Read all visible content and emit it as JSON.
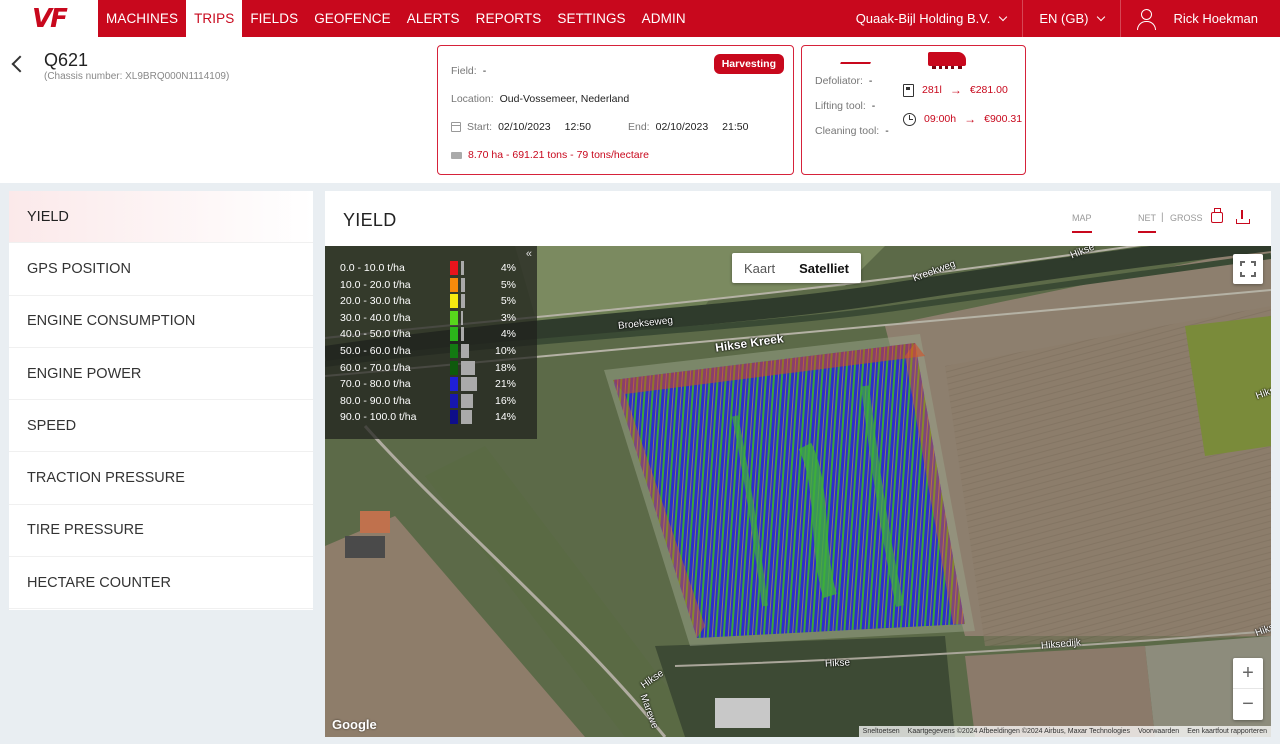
{
  "brand": {
    "logo_text": "VF"
  },
  "nav": {
    "items": [
      {
        "label": "MACHINES"
      },
      {
        "label": "TRIPS"
      },
      {
        "label": "FIELDS"
      },
      {
        "label": "GEOFENCE"
      },
      {
        "label": "ALERTS"
      },
      {
        "label": "REPORTS"
      },
      {
        "label": "SETTINGS"
      },
      {
        "label": "ADMIN"
      }
    ],
    "active": "TRIPS",
    "company": "Quaak-Bijl Holding B.V.",
    "language": "EN (GB)",
    "user": "Rick Hoekman"
  },
  "machine": {
    "title": "Q621",
    "chassis": "(Chassis number: XL9BRQ000N1114109)"
  },
  "trip": {
    "status": "Harvesting",
    "field_label": "Field:",
    "field_value": "-",
    "location_label": "Location:",
    "location_value": "Oud-Vossemeer, Nederland",
    "start_label": "Start:",
    "start_date": "02/10/2023",
    "start_time": "12:50",
    "end_label": "End:",
    "end_date": "02/10/2023",
    "end_time": "21:50",
    "summary": "8.70 ha - 691.21 tons - 79 tons/hectare"
  },
  "tools": {
    "defoliator_label": "Defoliator:",
    "defoliator_value": "-",
    "lifting_label": "Lifting tool:",
    "lifting_value": "-",
    "cleaning_label": "Cleaning tool:",
    "cleaning_value": "-",
    "fuel": "281l",
    "fuel_cost": "€281.00",
    "hours": "09:00h",
    "hours_cost": "€900.31"
  },
  "sidebar": {
    "items": [
      {
        "label": "YIELD"
      },
      {
        "label": "GPS POSITION"
      },
      {
        "label": "ENGINE CONSUMPTION"
      },
      {
        "label": "ENGINE POWER"
      },
      {
        "label": "SPEED"
      },
      {
        "label": "TRACTION PRESSURE"
      },
      {
        "label": "TIRE PRESSURE"
      },
      {
        "label": "HECTARE COUNTER"
      }
    ],
    "active": "YIELD"
  },
  "panel": {
    "title": "YIELD",
    "tab_map": "MAP",
    "tab_net": "NET",
    "separator": "|",
    "tab_gross": "GROSS"
  },
  "legend": {
    "collapse": "«",
    "rows": [
      {
        "label": "0.0 - 10.0 t/ha",
        "pct": "4%",
        "value": 4,
        "color": "#e8141c"
      },
      {
        "label": "10.0 - 20.0 t/ha",
        "pct": "5%",
        "value": 5,
        "color": "#f58a0b"
      },
      {
        "label": "20.0 - 30.0 t/ha",
        "pct": "5%",
        "value": 5,
        "color": "#f6ea10"
      },
      {
        "label": "30.0 - 40.0 t/ha",
        "pct": "3%",
        "value": 3,
        "color": "#58d61c"
      },
      {
        "label": "40.0 - 50.0 t/ha",
        "pct": "4%",
        "value": 4,
        "color": "#2bb51a"
      },
      {
        "label": "50.0 - 60.0 t/ha",
        "pct": "10%",
        "value": 10,
        "color": "#137a12"
      },
      {
        "label": "60.0 - 70.0 t/ha",
        "pct": "18%",
        "value": 18,
        "color": "#0e5a0c"
      },
      {
        "label": "70.0 - 80.0 t/ha",
        "pct": "21%",
        "value": 21,
        "color": "#1f1fd8"
      },
      {
        "label": "80.0 - 90.0 t/ha",
        "pct": "16%",
        "value": 16,
        "color": "#1717b0"
      },
      {
        "label": "90.0 - 100.0 t/ha",
        "pct": "14%",
        "value": 14,
        "color": "#0e0e8a"
      }
    ]
  },
  "map": {
    "type_map": "Kaart",
    "type_satellite": "Satelliet",
    "selected_type": "Satelliet",
    "zoom_in": "+",
    "zoom_out": "−",
    "google": "Google",
    "roads": [
      "Kreekweg",
      "Hikse",
      "Broekseweg",
      "Hikse Kreek",
      "Hikseweg",
      "Hikse",
      "Hiksedijk",
      "Hikse",
      "Hikse",
      "Marewe"
    ],
    "attribution": [
      "Sneltoetsen",
      "Kaartgegevens ©2024 Afbeeldingen ©2024 Airbus, Maxar Technologies",
      "Voorwaarden",
      "Een kaartfout rapporteren"
    ]
  }
}
